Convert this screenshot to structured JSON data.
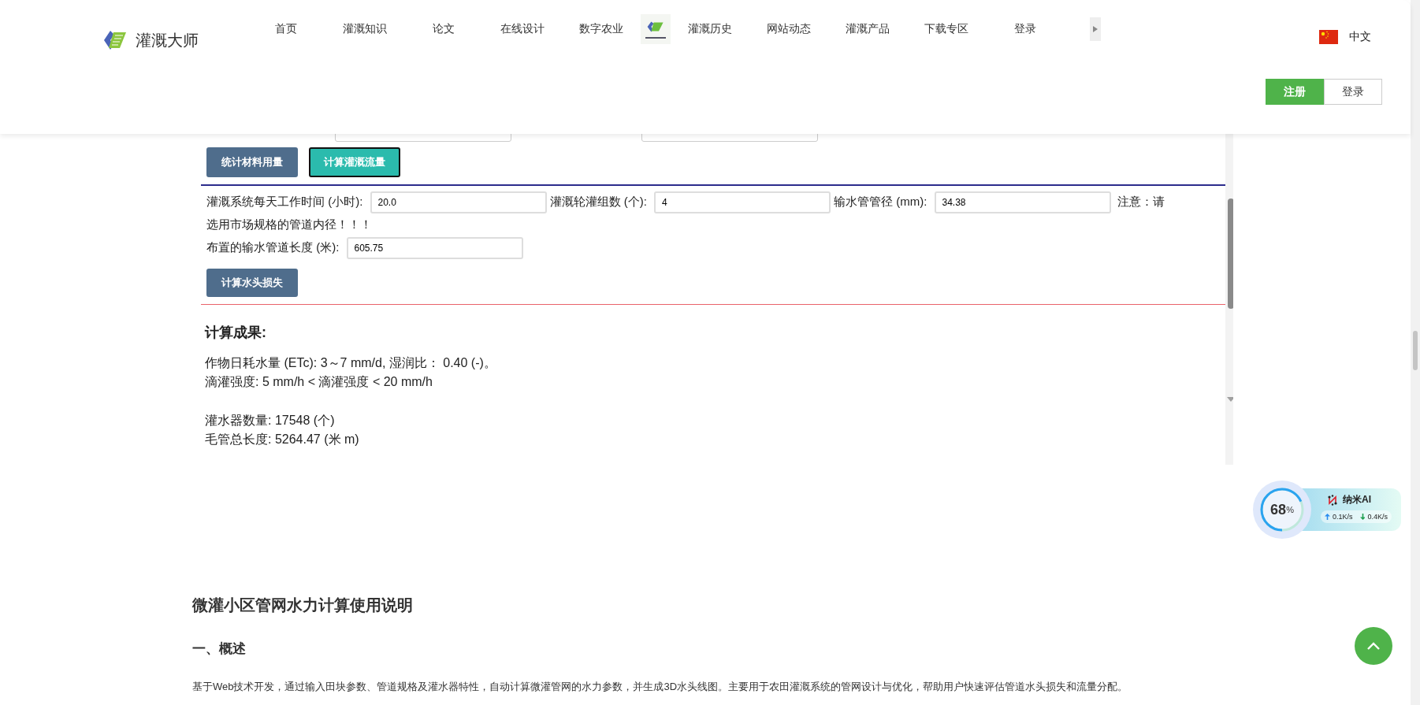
{
  "header": {
    "site_name": "灌溉大师",
    "nav": [
      {
        "kind": "link",
        "label": "首页"
      },
      {
        "kind": "link",
        "label": "灌溉知识"
      },
      {
        "kind": "link",
        "label": "论文"
      },
      {
        "kind": "link",
        "label": "在线设计"
      },
      {
        "kind": "link",
        "label": "数字农业"
      },
      {
        "kind": "image"
      },
      {
        "kind": "link",
        "label": "灌溉历史"
      },
      {
        "kind": "link",
        "label": "网站动态"
      },
      {
        "kind": "link",
        "label": "灌溉产品"
      },
      {
        "kind": "link",
        "label": "下载专区"
      },
      {
        "kind": "link",
        "label": "登录"
      }
    ],
    "language": "中文",
    "auth_buttons": [
      {
        "label": "注册",
        "primary": true
      },
      {
        "label": "登录",
        "primary": false
      }
    ]
  },
  "calculator": {
    "action_buttons": [
      {
        "label": "统计材料用量",
        "active": false
      },
      {
        "label": "计算灌溉流量",
        "active": true
      }
    ],
    "fields": [
      {
        "label": "灌溉系统每天工作时间 (小时):",
        "value": "20.0"
      },
      {
        "label": "灌溉轮灌组数 (个):",
        "value": "4"
      },
      {
        "label": "输水管管径 (mm):",
        "value": "34.38"
      }
    ],
    "note_lines": [
      "注意：请",
      "选用市场规格的管道内径！！！"
    ],
    "length_field": {
      "label": "布置的输水管道长度 (米):",
      "value": "605.75"
    },
    "head_loss_button": "计算水头损失",
    "results_title": "计算成果:",
    "result_groups": [
      [
        "作物日耗水量 (ETc): 3～7 mm/d, 湿润比： 0.40 (-)。",
        "滴灌强度: 5 mm/h < 滴灌强度 < 20 mm/h"
      ],
      [
        "灌水器数量: 17548 (个)",
        "毛管总长度: 5264.47 (米 m)"
      ]
    ]
  },
  "monitor": {
    "percent": "68",
    "unit": "%",
    "name": "纳米AI",
    "upload": "0.1K/s",
    "download": "0.4K/s"
  },
  "doc": {
    "title": "微灌小区管网水力计算使用说明",
    "section": "一、概述",
    "paragraph": "基于Web技术开发，通过输入田块参数、管道规格及灌水器特性，自动计算微灌管网的水力参数，并生成3D水头线图。主要用于农田灌溉系统的管网设计与优化，帮助用户快速评估管道水头损失和流量分配。"
  }
}
